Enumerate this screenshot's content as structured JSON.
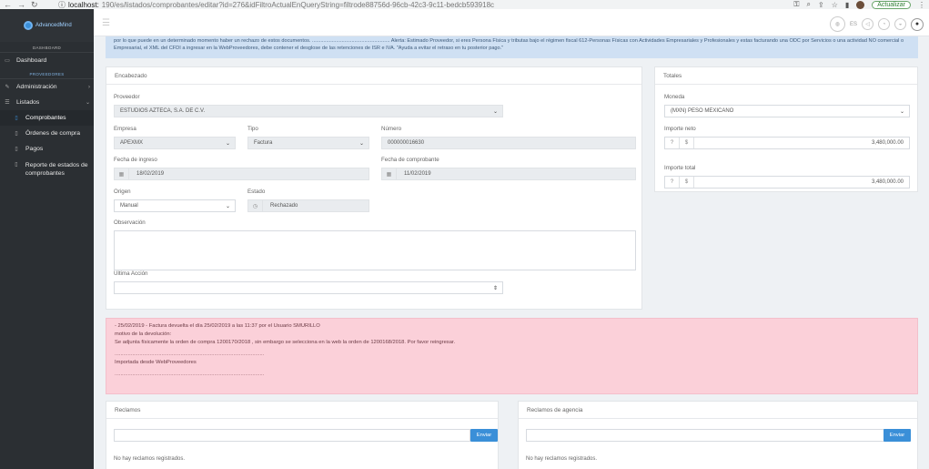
{
  "browser": {
    "url_host": "localhost:",
    "url_path": "190/es/listados/comprobantes/editar?id=276&idFiltroActualEnQueryString=filtrode88756d-96cb-42c3-9c11-bedcb593918c",
    "update_label": "Actualizar"
  },
  "sidebar": {
    "brand": "AdvancedMind",
    "section_dashboard": "DASHBOARD",
    "dashboard": "Dashboard",
    "section_proveedores": "PROVEEDORES",
    "administracion": "Administración",
    "listados": "Listados",
    "comprobantes": "Comprobantes",
    "ordenes": "Órdenes de compra",
    "pagos": "Pagos",
    "reporte": "Reporte de estados de comprobantes"
  },
  "topbar": {
    "lang": "ES"
  },
  "info_alert": "por lo que puede en un determinado momento haber un rechazo de estos documentos. ....................................................... Alerta: Estimado Proveedor, si eres Persona Física y tributas bajo el régimen fiscal 612-Personas Físicas con Actividades Empresariales y Profesionales y estas facturando una ODC por Servicios o una actividad NO comercial o Empresarial, el XML del CFDI a ingresar en la WebProveedores, debe contener el desglose de las retenciones de ISR e IVA. \"Ayuda a evitar el retraso en tu posterior pago.\"",
  "encabezado": {
    "title": "Encabezado",
    "proveedor_label": "Proveedor",
    "proveedor_value": "ESTUDIOS AZTECA, S.A. DE C.V.",
    "empresa_label": "Empresa",
    "empresa_value": "APEXMX",
    "tipo_label": "Tipo",
    "tipo_value": "Factura",
    "numero_label": "Número",
    "numero_value": "000000016630",
    "fecha_ingreso_label": "Fecha de ingreso",
    "fecha_ingreso_value": "18/02/2019",
    "fecha_comprobante_label": "Fecha de comprobante",
    "fecha_comprobante_value": "11/02/2019",
    "origen_label": "Origen",
    "origen_value": "Manual",
    "estado_label": "Estado",
    "estado_value": "Rechazado",
    "observacion_label": "Observación",
    "ultima_accion_label": "Ultima Acción"
  },
  "totales": {
    "title": "Totales",
    "moneda_label": "Moneda",
    "moneda_value": "(MXN) PESO MEXICANO",
    "importe_neto_label": "Importe neto",
    "importe_neto_value": "3,480,000.00",
    "importe_total_label": "Importe total",
    "importe_total_value": "3,480,000.00",
    "currency_symbol": "$"
  },
  "danger_alert": {
    "line1": "- 25/02/2019 - Factura devuelta el día 25/02/2019 a las 11:37 por el Usuario SMURILLO",
    "line2": "motivo de la devolución:",
    "line3": "Se adjunta físicamente la orden de compra 1200170/2018 , sin embargo se selecciona en la web la orden de 1200168/2018. Por favor reingresar.",
    "sep1": "......................................................................................................",
    "line4": "Importada desde WebProveedores",
    "sep2": "......................................................................................................"
  },
  "reclamos": {
    "title": "Reclamos",
    "send_label": "Enviar",
    "empty": "No hay reclamos registrados."
  },
  "reclamos_agencia": {
    "title": "Reclamos de agencia",
    "send_label": "Enviar",
    "empty": "No hay reclamos registrados."
  }
}
